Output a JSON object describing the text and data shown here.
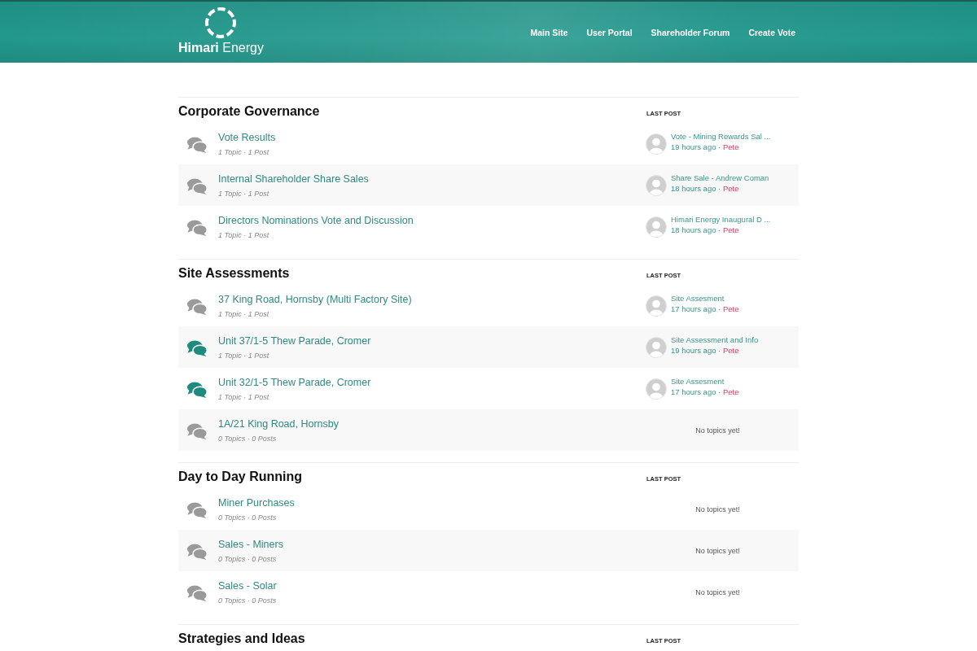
{
  "header": {
    "logo_text": "**Himari** Energy",
    "nav": [
      {
        "label": "Main Site"
      },
      {
        "label": "User Portal"
      },
      {
        "label": "Shareholder Forum"
      },
      {
        "label": "Create Vote"
      }
    ]
  },
  "sections": [
    {
      "title": "Corporate Governance",
      "last_post_heading": "LAST POST",
      "forums": [
        {
          "title": "Vote Results",
          "meta": "1 Topic · 1 Post",
          "unread": false,
          "last_post": {
            "kind": "post",
            "title": "Vote - Mining Rewards Sal ...",
            "time": "19 hours ago ·",
            "author": "Pete"
          }
        },
        {
          "title": "Internal Shareholder Share Sales",
          "meta": "1 Topic · 1 Post",
          "unread": false,
          "last_post": {
            "kind": "post",
            "title": "Share Sale - Andrew Coman",
            "time": "18 hours ago ·",
            "author": "Pete"
          }
        },
        {
          "title": "Directors Nominations Vote and Discussion",
          "meta": "1 Topic · 1 Post",
          "unread": false,
          "last_post": {
            "kind": "post",
            "title": "Himari Energy Inaugural D ...",
            "time": "18 hours ago ·",
            "author": "Pete"
          }
        }
      ]
    },
    {
      "title": "Site Assessments",
      "last_post_heading": "LAST POST",
      "forums": [
        {
          "title": "37 King Road, Hornsby (Multi Factory Site)",
          "meta": "1 Topic · 1 Post",
          "unread": false,
          "last_post": {
            "kind": "post",
            "title": "Site Assesment",
            "time": "17 hours ago ·",
            "author": "Pete"
          }
        },
        {
          "title": "Unit 37/1-5 Thew Parade, Cromer",
          "meta": "1 Topic · 1 Post",
          "unread": true,
          "last_post": {
            "kind": "post",
            "title": "Site Assessment and Info",
            "time": "19 hours ago ·",
            "author": "Pete"
          }
        },
        {
          "title": "Unit 32/1-5 Thew Parade, Cromer",
          "meta": "1 Topic · 1 Post",
          "unread": true,
          "last_post": {
            "kind": "post",
            "title": "Site Assesment",
            "time": "17 hours ago ·",
            "author": "Pete"
          }
        },
        {
          "title": "1A/21 King Road, Hornsby",
          "meta": "0 Topics · 0 Posts",
          "unread": false,
          "last_post": {
            "kind": "empty",
            "note": "No topics yet!"
          }
        }
      ]
    },
    {
      "title": "Day to Day Running",
      "last_post_heading": "LAST POST",
      "forums": [
        {
          "title": "Miner Purchases",
          "meta": "0 Topics · 0 Posts",
          "unread": false,
          "last_post": {
            "kind": "empty",
            "note": "No topics yet!"
          }
        },
        {
          "title": "Sales - Miners",
          "meta": "0 Topics · 0 Posts",
          "unread": false,
          "last_post": {
            "kind": "empty",
            "note": "No topics yet!"
          }
        },
        {
          "title": "Sales - Solar",
          "meta": "0 Topics · 0 Posts",
          "unread": false,
          "last_post": {
            "kind": "empty",
            "note": "No topics yet!"
          }
        }
      ]
    },
    {
      "title": "Strategies and Ideas",
      "last_post_heading": "LAST POST"
    }
  ]
}
